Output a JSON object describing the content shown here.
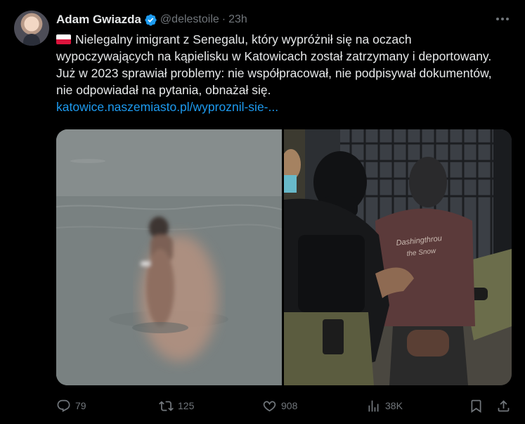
{
  "tweet": {
    "author_name": "Adam Gwiazda",
    "handle": "@delestoile",
    "separator": "·",
    "time": "23h",
    "text": "Nielegalny imigrant z Senegalu, który wypróżnił się na oczach wypoczywających na kąpielisku w Katowicach został zatrzymany i deportowany. Już w 2023 sprawiał problemy: nie współpracował, nie podpisywał dokumentów, nie odpowiadał na pytania, obnażał się.",
    "link": "katowice.naszemiasto.pl/wyproznil-sie-...",
    "shirt_text_line1": "Dashingthrou",
    "shirt_text_line2": "the Snow"
  },
  "actions": {
    "replies": "79",
    "reposts": "125",
    "likes": "908",
    "views": "38K"
  },
  "colors": {
    "background": "#000000",
    "text": "#e7e9ea",
    "secondary": "#71767b",
    "link": "#1d9bf0",
    "verified": "#1d9bf0"
  },
  "icons": {
    "flag": "poland-flag-icon",
    "verified": "verified-badge-icon",
    "more": "more-options-icon",
    "reply": "reply-icon",
    "repost": "repost-icon",
    "like": "like-icon",
    "views": "views-icon",
    "bookmark": "bookmark-icon",
    "share": "share-icon"
  }
}
